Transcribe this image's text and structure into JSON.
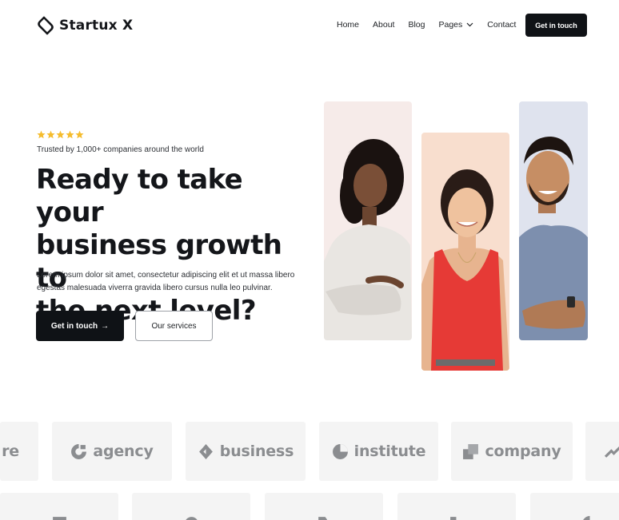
{
  "header": {
    "brand": "Startux X",
    "nav": [
      "Home",
      "About",
      "Blog",
      "Pages",
      "Contact"
    ],
    "cta_label": "Get in touch"
  },
  "hero": {
    "rating_stars": 5,
    "trusted_text": "Trusted by 1,000+ companies around the world",
    "headline_lines": [
      "Ready to take your",
      "business growth to",
      "the next level?"
    ],
    "description_lines": [
      "Lorem ipsum dolor sit amet, consectetur adipiscing elit et ut massa libero",
      "egestas malesuada viverra gravida libero cursus nulla leo pulvinar."
    ],
    "primary_button": "Get in touch",
    "primary_button_arrow": "→",
    "secondary_button": "Our services"
  },
  "logos": {
    "row1": [
      "re",
      "agency",
      "business",
      "institute",
      "company"
    ]
  },
  "colors": {
    "accent_dark": "#0f1216",
    "star": "#f5bc2d",
    "card_pink": "#f6ebe9",
    "card_peach": "#f8dece",
    "card_blue": "#dfe3ee",
    "logo_tile": "#f4f4f4",
    "logo_text": "#8b8d90"
  },
  "icons": [
    "startux-logo-icon",
    "chevron-down-icon",
    "star-icon",
    "arrow-right-icon",
    "agency-logo-icon",
    "business-logo-icon",
    "institute-logo-icon",
    "company-logo-icon",
    "trend-logo-icon"
  ]
}
